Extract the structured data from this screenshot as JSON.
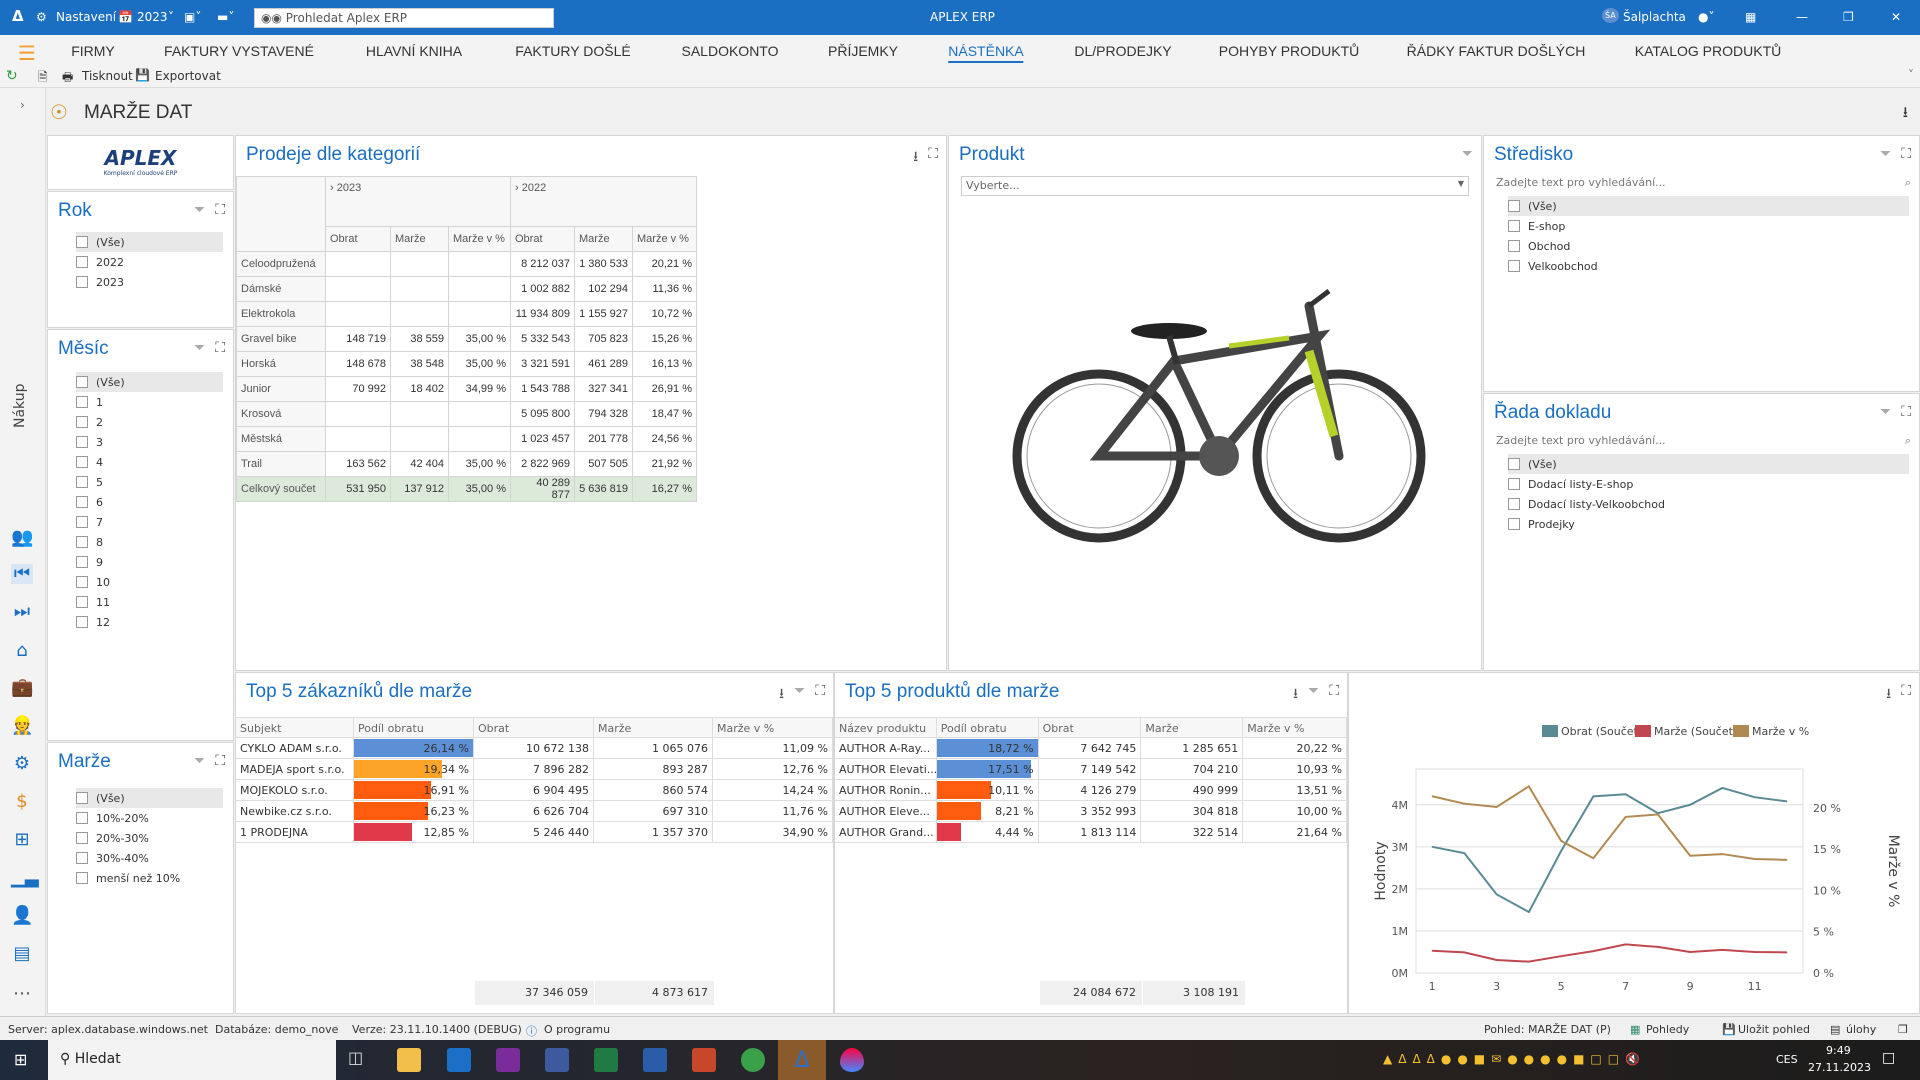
{
  "titlebar": {
    "settings": "Nastavení",
    "year": "2023",
    "search_placeholder": "Prohledat Aplex ERP",
    "app_title": "APLEX ERP",
    "user_initials": "ŠA",
    "user": "Šalplachta"
  },
  "menu": [
    "FIRMY",
    "FAKTURY VYSTAVENÉ",
    "HLAVNÍ KNIHA",
    "FAKTURY DOŠLÉ",
    "SALDOKONTO",
    "PŘÍJEMKY",
    "NÁSTĚNKA",
    "DL/PRODEJKY",
    "POHYBY PRODUKTŮ",
    "ŘÁDKY FAKTUR DOŠLÝCH",
    "KATALOG PRODUKTŮ"
  ],
  "toolbar": {
    "print": "Tisknout",
    "export": "Exportovat"
  },
  "page_title": "MARŽE DAT",
  "rail_label": "Nákup",
  "logo": {
    "name": "APLEX",
    "tagline": "Komplexní cloudové ERP"
  },
  "filters": {
    "rok": {
      "title": "Rok",
      "items": [
        "(Vše)",
        "2022",
        "2023"
      ]
    },
    "mesic": {
      "title": "Měsíc",
      "items": [
        "(Vše)",
        "1",
        "2",
        "3",
        "4",
        "5",
        "6",
        "7",
        "8",
        "9",
        "10",
        "11",
        "12"
      ]
    },
    "marze": {
      "title": "Marže",
      "items": [
        "(Vše)",
        "10%-20%",
        "20%-30%",
        "30%-40%",
        "menší než 10%"
      ]
    },
    "stredisko": {
      "title": "Středisko",
      "placeholder": "Zadejte text pro vyhledávání...",
      "items": [
        "(Vše)",
        "E-shop",
        "Obchod",
        "Velkoobchod"
      ]
    },
    "rada": {
      "title": "Řada dokladu",
      "placeholder": "Zadejte text pro vyhledávání...",
      "items": [
        "(Vše)",
        "Dodací listy-E-shop",
        "Dodací listy-Velkoobchod",
        "Prodejky"
      ]
    }
  },
  "pivot": {
    "title": "Prodeje dle kategorií",
    "years": [
      "2023",
      "2022"
    ],
    "measures": [
      "Obrat",
      "Marže",
      "Marže v %"
    ],
    "rows": [
      [
        "Celoodpružená",
        "",
        "",
        "",
        "8 212 037",
        "1 380 533",
        "20,21 %"
      ],
      [
        "Dámské",
        "",
        "",
        "",
        "1 002 882",
        "102 294",
        "11,36 %"
      ],
      [
        "Elektrokola",
        "",
        "",
        "",
        "11 934 809",
        "1 155 927",
        "10,72 %"
      ],
      [
        "Gravel bike",
        "148 719",
        "38 559",
        "35,00 %",
        "5 332 543",
        "705 823",
        "15,26 %"
      ],
      [
        "Horská",
        "148 678",
        "38 548",
        "35,00 %",
        "3 321 591",
        "461 289",
        "16,13 %"
      ],
      [
        "Junior",
        "70 992",
        "18 402",
        "34,99 %",
        "1 543 788",
        "327 341",
        "26,91 %"
      ],
      [
        "Krosová",
        "",
        "",
        "",
        "5 095 800",
        "794 328",
        "18,47 %"
      ],
      [
        "Městská",
        "",
        "",
        "",
        "1 023 457",
        "201 778",
        "24,56 %"
      ],
      [
        "Trail",
        "163 562",
        "42 404",
        "35,00 %",
        "2 822 969",
        "507 505",
        "21,92 %"
      ],
      [
        "Celkový součet",
        "531 950",
        "137 912",
        "35,00 %",
        "40 289 877",
        "5 636 819",
        "16,27 %"
      ]
    ]
  },
  "produkt": {
    "title": "Produkt",
    "placeholder": "Vyberte..."
  },
  "top_customers": {
    "title": "Top 5 zákazníků dle marže",
    "columns": [
      "Subjekt",
      "Podíl obratu",
      "Obrat",
      "Marže",
      "Marže v %"
    ],
    "rows": [
      {
        "name": "CYKLO ADAM s.r.o.",
        "share": "26,14 %",
        "share_value": 26.14,
        "color": "#5b8fd6",
        "obrat": "10 672 138",
        "marze": "1 065 076",
        "pct": "11,09 %"
      },
      {
        "name": "MADEJA sport s.r.o.",
        "share": "19,34 %",
        "share_value": 19.34,
        "color": "#fba428",
        "obrat": "7 896 282",
        "marze": "893 287",
        "pct": "12,76 %"
      },
      {
        "name": "MOJEKOLO s.r.o.",
        "share": "16,91 %",
        "share_value": 16.91,
        "color": "#ff5c0f",
        "obrat": "6 904 495",
        "marze": "860 574",
        "pct": "14,24 %"
      },
      {
        "name": "Newbike.cz s.r.o.",
        "share": "16,23 %",
        "share_value": 16.23,
        "color": "#ff5c0f",
        "obrat": "6 626 704",
        "marze": "697 310",
        "pct": "11,76 %"
      },
      {
        "name": "1 PRODEJNA",
        "share": "12,85 %",
        "share_value": 12.85,
        "color": "#e03a4a",
        "obrat": "5 246 440",
        "marze": "1 357 370",
        "pct": "34,90 %"
      }
    ],
    "sum_obrat": "37 346 059",
    "sum_marze": "4 873 617"
  },
  "top_products": {
    "title": "Top 5 produktů dle marže",
    "columns": [
      "Název produktu",
      "Podíl obratu",
      "Obrat",
      "Marže",
      "Marže v %"
    ],
    "rows": [
      {
        "name": "AUTHOR A-Ray...",
        "share": "18,72 %",
        "share_value": 18.72,
        "color": "#5b8fd6",
        "obrat": "7 642 745",
        "marze": "1 285 651",
        "pct": "20,22 %"
      },
      {
        "name": "AUTHOR Elevati...",
        "share": "17,51 %",
        "share_value": 17.51,
        "color": "#5b8fd6",
        "obrat": "7 149 542",
        "marze": "704 210",
        "pct": "10,93 %"
      },
      {
        "name": "AUTHOR Ronin...",
        "share": "10,11 %",
        "share_value": 10.11,
        "color": "#ff5c0f",
        "obrat": "4 126 279",
        "marze": "490 999",
        "pct": "13,51 %"
      },
      {
        "name": "AUTHOR Eleve...",
        "share": "8,21 %",
        "share_value": 8.21,
        "color": "#ff5c0f",
        "obrat": "3 352 993",
        "marze": "304 818",
        "pct": "10,00 %"
      },
      {
        "name": "AUTHOR Grand...",
        "share": "4,44 %",
        "share_value": 4.44,
        "color": "#e03a4a",
        "obrat": "1 813 114",
        "marze": "322 514",
        "pct": "21,64 %"
      }
    ],
    "sum_obrat": "24 084 672",
    "sum_marze": "3 108 191"
  },
  "chart_data": {
    "type": "line",
    "x": [
      1,
      2,
      3,
      4,
      5,
      6,
      7,
      8,
      9,
      10,
      11,
      12
    ],
    "xticks": [
      "1",
      "3",
      "5",
      "7",
      "9",
      "11"
    ],
    "ylabel": "Hodnoty",
    "y2label": "Marže v %",
    "ylim": [
      0,
      4.85
    ],
    "y2lim": [
      0,
      24.7
    ],
    "yticks": [
      "0M",
      "1M",
      "2M",
      "3M",
      "4M"
    ],
    "y2ticks": [
      "0 %",
      "5 %",
      "10 %",
      "15 %",
      "20 %"
    ],
    "legend": "top-right",
    "grid": true,
    "series": [
      {
        "name": "Obrat (Součet)",
        "axis": "left",
        "color": "#5a8a94",
        "values": [
          3.0,
          2.85,
          1.87,
          1.45,
          2.9,
          4.2,
          4.25,
          3.8,
          4.0,
          4.4,
          4.18,
          4.08
        ]
      },
      {
        "name": "Marže (Součet)",
        "axis": "left",
        "color": "#c0474f",
        "values": [
          0.53,
          0.49,
          0.31,
          0.27,
          0.4,
          0.52,
          0.68,
          0.62,
          0.5,
          0.55,
          0.5,
          0.49
        ]
      },
      {
        "name": "Marže v %",
        "axis": "right",
        "color": "#b08a50",
        "values": [
          21.4,
          20.5,
          20.1,
          22.6,
          16.0,
          13.9,
          18.9,
          19.2,
          14.2,
          14.4,
          13.8,
          13.7
        ]
      }
    ]
  },
  "status": {
    "server": "Server: aplex.database.windows.net",
    "database": "Databáze: demo_nove",
    "version": "Verze: 23.11.10.1400 (DEBUG)",
    "about": "O programu",
    "view": "Pohled: MARŽE DAT (P)",
    "views": "Pohledy",
    "save_view": "Uložit pohled",
    "tasks": "úlohy"
  },
  "taskbar": {
    "search": "Hledat",
    "lang": "CES",
    "time": "9:49",
    "date": "27.11.2023"
  }
}
